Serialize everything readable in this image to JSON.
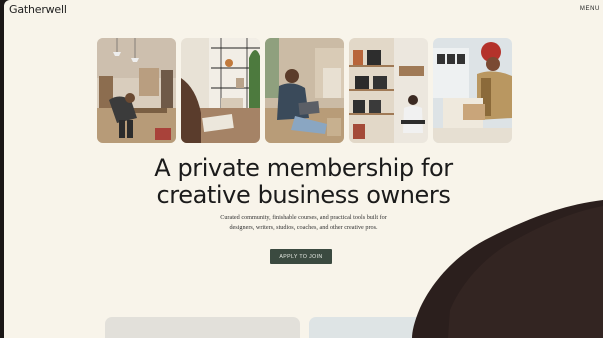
{
  "header": {
    "logo": "Gatherwell",
    "menu_label": "MENU"
  },
  "hero": {
    "headline_line1": "A private membership for",
    "headline_line2": "creative business owners",
    "subtext_line1": "Curated community, finishable courses, and practical tools built for",
    "subtext_line2": "designers, writers, studios, coaches, and other creative pros.",
    "cta_label": "APPLY TO JOIN"
  },
  "photos": [
    {
      "icon": "studio-workspace-image"
    },
    {
      "icon": "desk-shelves-image"
    },
    {
      "icon": "laptop-on-floor-image"
    },
    {
      "icon": "shop-shelves-image"
    },
    {
      "icon": "packing-boxes-image"
    }
  ],
  "colors": {
    "page_background": "#f8f4ea",
    "cta_background": "#3b4a40",
    "headline": "#1b1b1b"
  }
}
